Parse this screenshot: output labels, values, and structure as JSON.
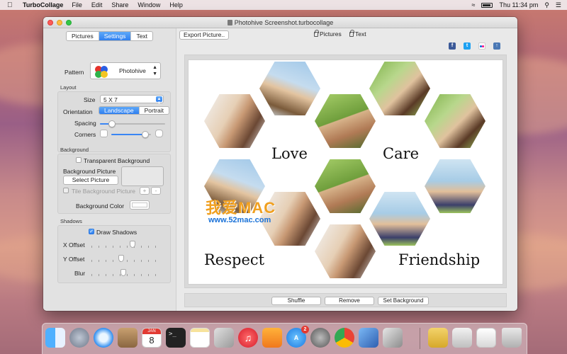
{
  "menubar": {
    "app_name": "TurboCollage",
    "items": [
      "File",
      "Edit",
      "Share",
      "Window",
      "Help"
    ],
    "clock": "Thu 11:34 pm"
  },
  "window": {
    "title": "Photohive Screenshot.turbocollage"
  },
  "sidebar": {
    "tabs": [
      "Pictures",
      "Settings",
      "Text"
    ],
    "active_tab": "Settings",
    "pattern_label": "Pattern",
    "pattern_value": "Photohive",
    "layout_section": "Layout",
    "size_label": "Size",
    "size_value": "5 X 7",
    "orientation_label": "Orientation",
    "orientation_options": [
      "Landscape",
      "Portrait"
    ],
    "orientation_selected": "Landscape",
    "spacing_label": "Spacing",
    "spacing_value": 0.18,
    "corners_label": "Corners",
    "corners_value": 0.85,
    "background_section": "Background",
    "transparent_bg_label": "Transparent Background",
    "transparent_bg_checked": false,
    "bg_picture_label": "Background Picture",
    "select_picture_button": "Select Picture",
    "tile_bg_label": "Tile Background Picture",
    "tile_plus": "+",
    "tile_minus": "-",
    "bg_color_label": "Background Color",
    "bg_color_value": "#ffffff",
    "shadows_section": "Shadows",
    "draw_shadows_label": "Draw Shadows",
    "draw_shadows_checked": true,
    "x_offset_label": "X Offset",
    "x_offset_value": 0.58,
    "y_offset_label": "Y Offset",
    "y_offset_value": 0.42,
    "blur_label": "Blur",
    "blur_value": 0.45
  },
  "main": {
    "export_button": "Export Picture..",
    "lock_pictures": "Pictures",
    "lock_text": "Text",
    "social_icons": [
      "facebook-icon",
      "twitter-icon",
      "flickr-icon",
      "share-icon"
    ],
    "captions": {
      "love": "Love",
      "care": "Care",
      "respect": "Respect",
      "friendship": "Friendship"
    },
    "watermark_cn": "我爱MAC",
    "watermark_url": "www.52mac.com",
    "bottom_buttons": [
      "Shuffle",
      "Remove",
      "Set Background"
    ]
  },
  "dock": {
    "calendar_month": "JAN",
    "calendar_day": "8",
    "appstore_badge": "2"
  },
  "colors": {
    "accent": "#2f7ff0",
    "window_bg": "#e9e9e9"
  }
}
